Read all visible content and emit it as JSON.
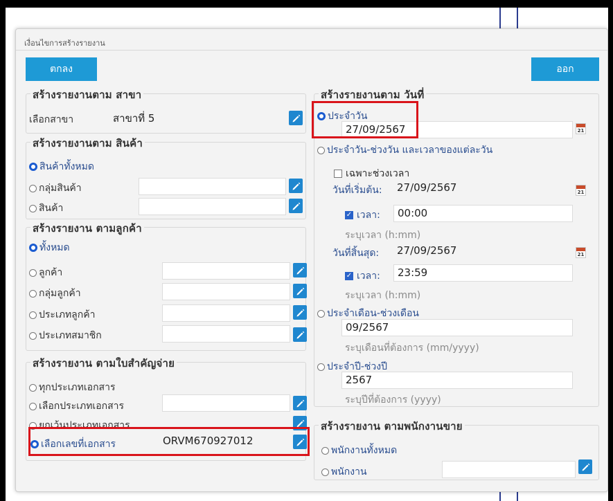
{
  "dialog": {
    "title": "เงื่อนไขการสร้างรายงาน",
    "ok_label": "ตกลง",
    "exit_label": "ออก"
  },
  "branch": {
    "legend": "สร้างรายงานตาม สาขา",
    "label": "เลือกสาขา",
    "value": "สาขาที่ 5"
  },
  "product": {
    "legend": "สร้างรายงานตาม สินค้า",
    "all": "สินค้าทั้งหมด",
    "group": "กลุ่มสินค้า",
    "item": "สินค้า"
  },
  "customer": {
    "legend": "สร้างรายงาน ตามลูกค้า",
    "all": "ทั้งหมด",
    "customer": "ลูกค้า",
    "group": "กลุ่มลูกค้า",
    "type": "ประเภทลูกค้า",
    "member_type": "ประเภทสมาชิก"
  },
  "document": {
    "legend": "สร้างรายงาน ตามใบสำคัญจ่าย",
    "all_types": "ทุกประเภทเอกสาร",
    "select_type": "เลือกประเภทเอกสาร",
    "except_type": "ยกเว้นประเภทเอกสาร",
    "doc_no_label": "เลือกเลขที่เอกสาร",
    "doc_no_value": "ORVM670927012"
  },
  "date": {
    "legend": "สร้างรายงานตาม วันที่",
    "daily": "ประจำวัน",
    "daily_value": "27/09/2567",
    "daily_range": "ประจำวัน-ช่วงวัน และเวลาของแต่ละวัน",
    "time_only": "เฉพาะช่วงเวลา",
    "start_label": "วันที่เริ่มต้น:",
    "start_value": "27/09/2567",
    "time_label": "เวลา:",
    "start_time": "00:00",
    "time_help": "ระบุเวลา (h:mm)",
    "end_label": "วันที่สิ้นสุด:",
    "end_value": "27/09/2567",
    "end_time": "23:59",
    "month_range": "ประจำเดือน-ช่วงเดือน",
    "month_value": "09/2567",
    "month_help": "ระบุเดือนที่ต้องการ (mm/yyyy)",
    "year_range": "ประจำปี-ช่วงปี",
    "year_value": "2567",
    "year_help": "ระบุปีที่ต้องการ (yyyy)",
    "calendar_month": "Apr",
    "calendar_day": "21"
  },
  "salesperson": {
    "legend": "สร้างรายงาน ตามพนักงานขาย",
    "all": "พนักงานทั้งหมด",
    "employee": "พนักงาน"
  },
  "colors": {
    "accent": "#1e9ad6",
    "highlight": "#d9141b",
    "selected_radio": "#1a5bd0"
  }
}
